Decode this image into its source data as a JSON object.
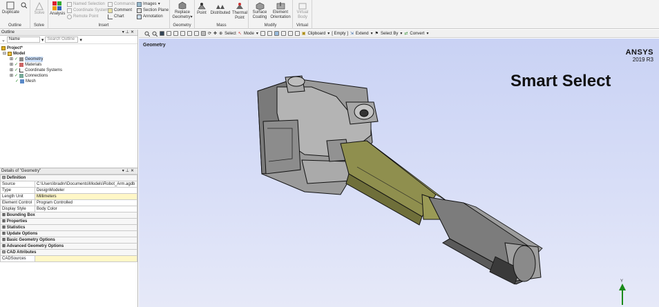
{
  "ribbon": {
    "outline": {
      "duplicate": "Duplicate",
      "group": "Outline"
    },
    "solve": {
      "solve": "Solve",
      "group": "Solve"
    },
    "insert": {
      "analysis": "Analysis",
      "named_selection": "Named Selection",
      "coordinate_system": "Coordinate System",
      "remote_point": "Remote Point",
      "commands": "Commands",
      "comment": "Comment",
      "chart": "Chart",
      "images": "Images",
      "section_plane": "Section Plane",
      "annotation": "Annotation",
      "group": "Insert"
    },
    "geometry": {
      "replace": "Replace",
      "geometry": "Geometry",
      "group": "Geometry"
    },
    "mass": {
      "point": "Point",
      "distributed": "Distributed",
      "thermal": "Thermal",
      "thermal_point": "Point",
      "group": "Mass"
    },
    "modify": {
      "surface": "Surface",
      "coating": "Coating",
      "element": "Element",
      "orientation": "Orientation",
      "group": "Modify"
    },
    "virtual": {
      "virtual": "Virtual",
      "body": "Body",
      "group": "Virtual"
    }
  },
  "outline": {
    "title": "Outline",
    "filter_name": "Name",
    "search_placeholder": "Search Outline",
    "tree": {
      "project": "Project*",
      "model": "Model",
      "geometry": "Geometry",
      "materials": "Materials",
      "coordinate_systems": "Coordinate Systems",
      "connections": "Connections",
      "mesh": "Mesh"
    }
  },
  "details": {
    "title": "Details of \"Geometry\"",
    "definition": "Definition",
    "rows": [
      {
        "key": "Source",
        "value": "C:\\Users\\bradnr\\Documents\\Models\\Robot_Arm.agdb"
      },
      {
        "key": "Type",
        "value": "DesignModeler"
      },
      {
        "key": "Length Unit",
        "value": "Millimeters"
      },
      {
        "key": "Element Control",
        "value": "Program Controlled"
      },
      {
        "key": "Display Style",
        "value": "Body Color"
      }
    ],
    "sections": [
      "Bounding Box",
      "Properties",
      "Statistics",
      "Update Options",
      "Basic Geometry Options",
      "Advanced Geometry Options"
    ],
    "cad": "CAD Attributes",
    "cad_row": "CADSources"
  },
  "toolbar": {
    "select": "Select",
    "mode": "Mode",
    "clipboard": "Clipboard",
    "empty": "[ Empty ]",
    "extend": "Extend",
    "select_by": "Select By",
    "convert": "Convert"
  },
  "viewport": {
    "label": "Geometry",
    "brand": "ANSYS",
    "version": "2019 R3",
    "overlay": "Smart Select",
    "triad_y": "Y"
  },
  "colors": {
    "viewport_top": "#c9d2f4",
    "viewport_bottom": "#e6e9f8",
    "selection_face": "#8f8f4e",
    "body_gray": "#8a8a8a"
  }
}
